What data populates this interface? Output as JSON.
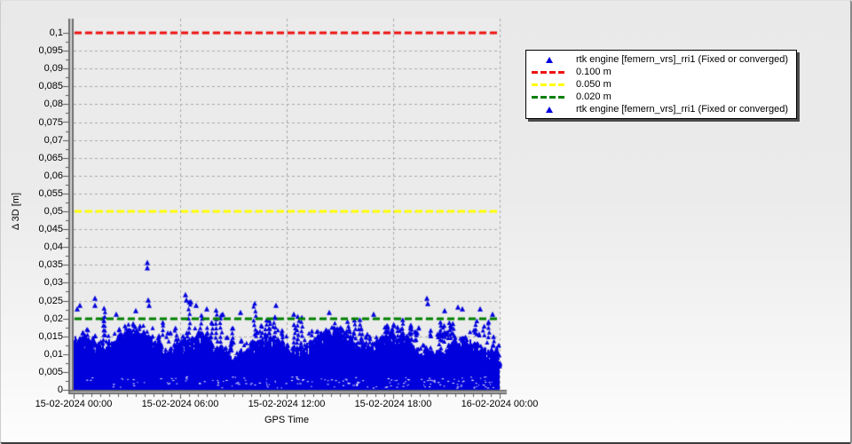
{
  "window": {
    "title": "rtk engine deviation plot"
  },
  "colors": {
    "plot_bg": "#ebebeb",
    "grid": "#a9a9a9",
    "axis_dark": "#6f6f6f",
    "axis_light": "#d2d2d2",
    "tick": "#555555",
    "marker_blue": "#0000dd",
    "ref_red": "#ee1111",
    "ref_yellow": "#ffff00",
    "ref_green": "#008000",
    "speckle": "#ffffff",
    "text": "#000000"
  },
  "chart_data": {
    "type": "scatter",
    "title": "",
    "xlabel": "GPS Time",
    "ylabel": "Δ 3D [m]",
    "x_axis": {
      "start_hours": 0,
      "end_hours": 24,
      "tick_hours": [
        0,
        6,
        12,
        18,
        24
      ],
      "tick_labels": [
        "15-02-2024 00:00",
        "15-02-2024 06:00",
        "15-02-2024 12:00",
        "15-02-2024 18:00",
        "16-02-2024 00:00"
      ],
      "minor_tick_minutes": 30
    },
    "y_axis": {
      "min": 0,
      "max": 0.1,
      "tick_step": 0.005,
      "minor_tick_step": 0.0025,
      "tick_labels": [
        "0",
        "0,005",
        "0,01",
        "0,015",
        "0,02",
        "0,025",
        "0,03",
        "0,035",
        "0,04",
        "0,045",
        "0,05",
        "0,055",
        "0,06",
        "0,065",
        "0,07",
        "0,075",
        "0,08",
        "0,085",
        "0,09",
        "0,095",
        "0,1"
      ]
    },
    "grid": {
      "style": "dashed",
      "shown": true
    },
    "series": [
      {
        "name": "rtk engine [femern_vrs]_rri1 (Fixed or converged)",
        "marker": "triangle",
        "color": "#0000dd",
        "summary": "dense noise band from 0 to ~0.018 m across full day, frequent spikes to 0.02-0.027 m, isolated outlier pair ~0.034-0.036 m near 04:10",
        "outliers_hours_m": [
          [
            0.2,
            0.0225
          ],
          [
            0.35,
            0.0235
          ],
          [
            1.2,
            0.0255
          ],
          [
            1.2,
            0.0235
          ],
          [
            2.4,
            0.021
          ],
          [
            3.5,
            0.022
          ],
          [
            4.15,
            0.0355
          ],
          [
            4.15,
            0.034
          ],
          [
            4.2,
            0.025
          ],
          [
            4.25,
            0.0235
          ],
          [
            6.3,
            0.0265
          ],
          [
            6.35,
            0.025
          ],
          [
            6.6,
            0.0245
          ],
          [
            6.9,
            0.0235
          ],
          [
            7.5,
            0.0225
          ],
          [
            8.4,
            0.021
          ],
          [
            9.4,
            0.0215
          ],
          [
            11.4,
            0.0235
          ],
          [
            12.4,
            0.021
          ],
          [
            14.4,
            0.0215
          ],
          [
            16.9,
            0.021
          ],
          [
            19.9,
            0.0255
          ],
          [
            19.95,
            0.024
          ],
          [
            20.9,
            0.022
          ],
          [
            21.65,
            0.023
          ],
          [
            21.9,
            0.0225
          ],
          [
            22.9,
            0.0225
          ],
          [
            23.6,
            0.021
          ]
        ],
        "profile": {
          "seed": 77,
          "dense_top_typical_m": 0.016,
          "dense_top_min_m": 0.008,
          "dense_top_max_m": 0.0185,
          "spike_count": 130,
          "spike_max_m": 0.025,
          "speckle_count": 170
        }
      }
    ],
    "reference_lines": [
      {
        "label": "0.100 m",
        "value_m": 0.1,
        "color": "#ee1111"
      },
      {
        "label": "0.050 m",
        "value_m": 0.05,
        "color": "#ffff00"
      },
      {
        "label": "0.020 m",
        "value_m": 0.02,
        "color": "#008000"
      }
    ],
    "legend": {
      "position": "right-top",
      "entries": [
        {
          "type": "marker",
          "color": "#0000dd",
          "label": "rtk engine [femern_vrs]_rri1 (Fixed or converged)"
        },
        {
          "type": "dash",
          "color": "#ee1111",
          "label": "0.100 m"
        },
        {
          "type": "dash",
          "color": "#ffff00",
          "label": "0.050 m"
        },
        {
          "type": "dash",
          "color": "#008000",
          "label": "0.020 m"
        },
        {
          "type": "marker",
          "color": "#0000dd",
          "label": "rtk engine [femern_vrs]_rri1 (Fixed or converged)"
        }
      ]
    }
  }
}
